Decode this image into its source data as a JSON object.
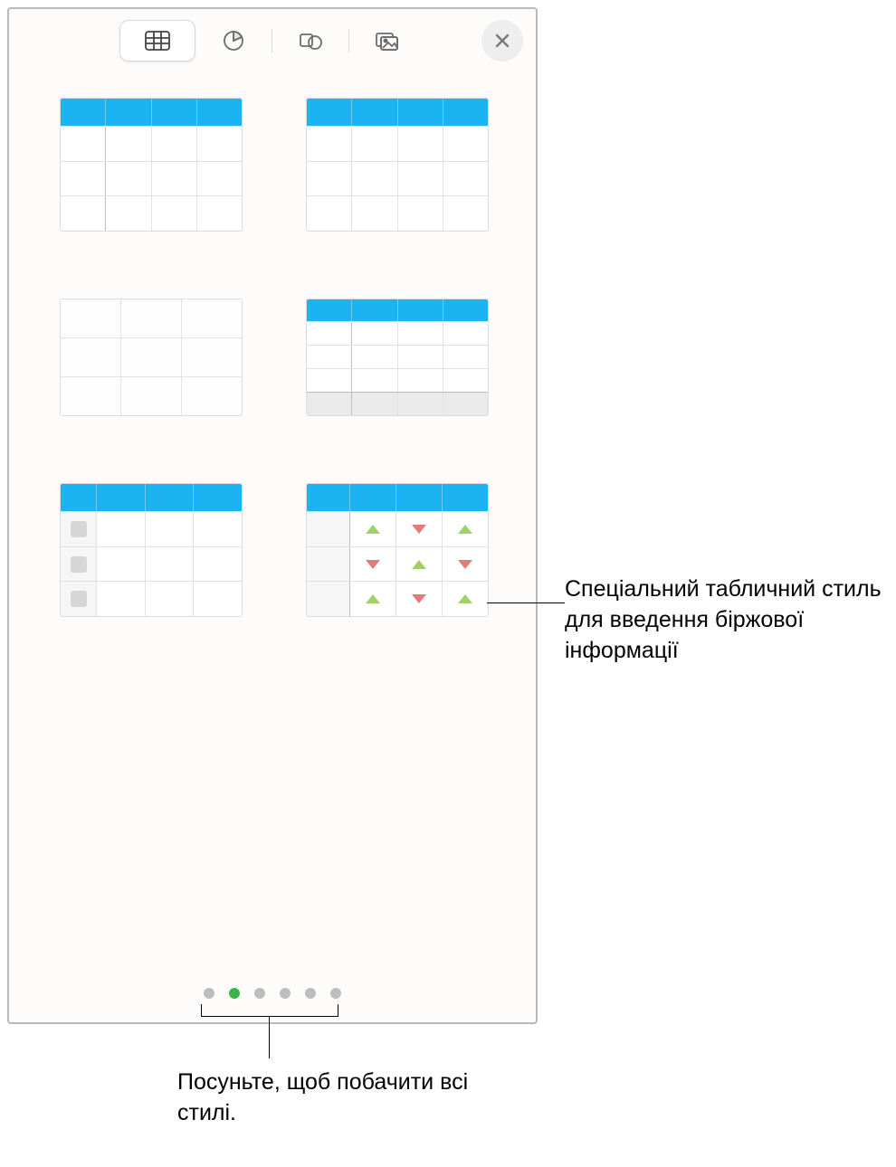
{
  "toolbar": {
    "tabs": [
      {
        "name": "table-tab",
        "icon": "table-icon",
        "active": true
      },
      {
        "name": "chart-tab",
        "icon": "pie-chart-icon",
        "active": false
      },
      {
        "name": "shape-tab",
        "icon": "shape-icon",
        "active": false
      },
      {
        "name": "media-tab",
        "icon": "image-icon",
        "active": false
      }
    ],
    "close": "close"
  },
  "styles_grid": {
    "rows": 3,
    "cols": 2,
    "items": [
      {
        "name": "table-style-blue-header-leadcol",
        "header_color": "#1cb3f2"
      },
      {
        "name": "table-style-blue-header-plain",
        "header_color": "#1cb3f2"
      },
      {
        "name": "table-style-no-header",
        "header_color": null
      },
      {
        "name": "table-style-header-footer-leadcol",
        "header_color": "#1cb3f2"
      },
      {
        "name": "table-style-checklist",
        "header_color": "#1cb3f2"
      },
      {
        "name": "table-style-stock",
        "header_color": "#1cb3f2"
      }
    ]
  },
  "stock_table": {
    "pattern": [
      [
        "up",
        "down",
        "up"
      ],
      [
        "down",
        "up",
        "down"
      ],
      [
        "up",
        "down",
        "up"
      ]
    ]
  },
  "pager": {
    "count": 6,
    "active_index": 1
  },
  "callouts": {
    "right": "Спеціальний табличний стиль для введення біржової інформації",
    "bottom": "Посуньте, щоб побачити всі стилі."
  },
  "colors": {
    "accent": "#1cb3f2",
    "dot_active": "#3bb54a",
    "triangle_up": "#9fd16b",
    "triangle_down": "#e27b7b"
  }
}
